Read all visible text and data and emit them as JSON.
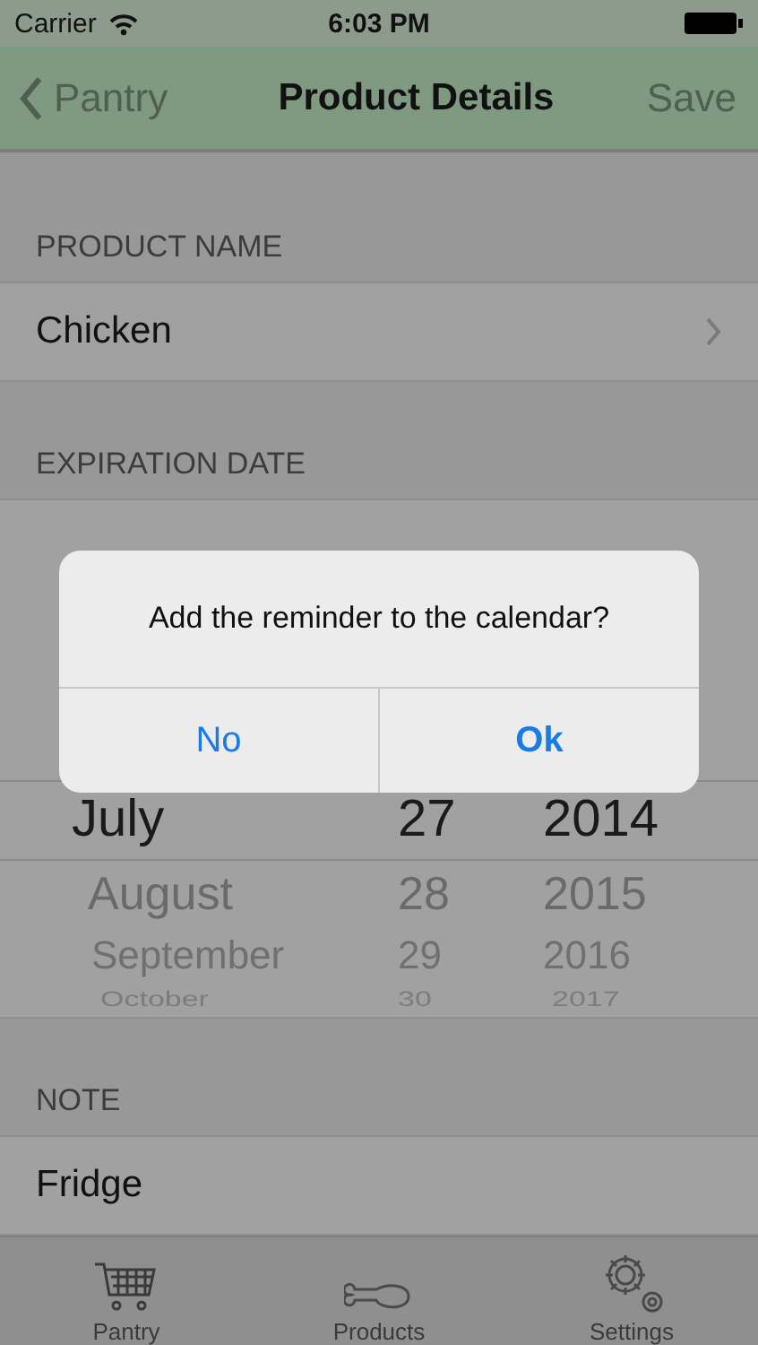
{
  "status_bar": {
    "carrier": "Carrier",
    "time": "6:03 PM"
  },
  "nav_bar": {
    "back": "Pantry",
    "title": "Product Details",
    "action": "Save"
  },
  "sections": [
    {
      "header": "PRODUCT NAME",
      "kind": "row",
      "value": "Chicken",
      "disclosure": true
    },
    {
      "header": "EXPIRATION DATE",
      "kind": "picker",
      "rows": [
        {
          "month": "July",
          "day": "27",
          "year": "2014",
          "selected": true
        },
        {
          "month": "August",
          "day": "28",
          "year": "2015",
          "selected": false
        },
        {
          "month": "September",
          "day": "29",
          "year": "2016",
          "selected": false
        },
        {
          "month": "October",
          "day": "30",
          "year": "2017",
          "selected": false
        }
      ]
    },
    {
      "header": "NOTE",
      "kind": "row",
      "value": "Fridge",
      "disclosure": false
    }
  ],
  "tab_bar": [
    {
      "label": "Pantry",
      "selected": false
    },
    {
      "label": "Products",
      "selected": false
    },
    {
      "label": "Settings",
      "selected": false
    }
  ],
  "alert": {
    "message": "Add the reminder to the calendar?",
    "buttons": [
      {
        "label": "No",
        "preferred": false
      },
      {
        "label": "Ok",
        "preferred": true
      }
    ]
  }
}
